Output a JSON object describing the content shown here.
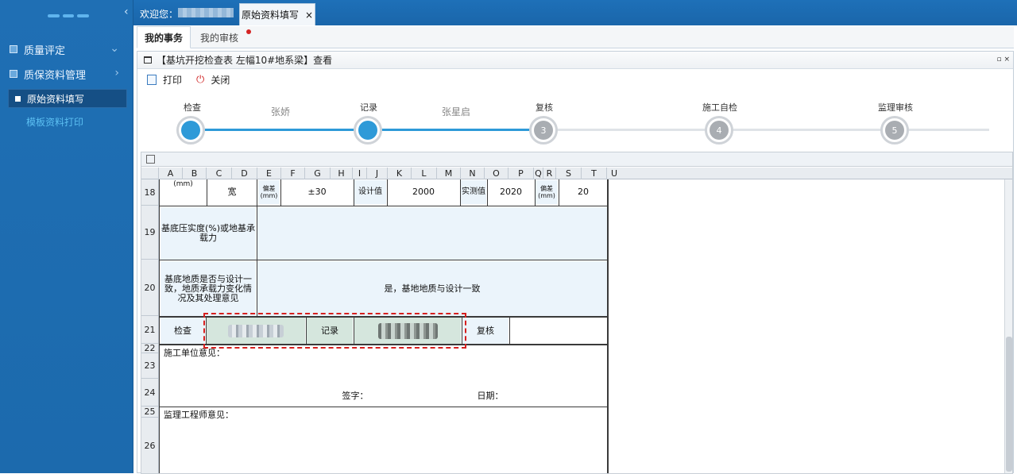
{
  "sidebar": {
    "items": [
      {
        "label": "质量评定",
        "expanded": true
      },
      {
        "label": "质保资料管理",
        "expanded": false
      }
    ],
    "subitems": [
      {
        "label": "原始资料填写",
        "active": true
      },
      {
        "label": "模板资料打印",
        "active": false
      }
    ]
  },
  "topbar": {
    "welcome": "欢迎您：",
    "tab_label": "原始资料填写",
    "tab_close": "×"
  },
  "subtabs": {
    "mine": "我的事务",
    "review": "我的审核"
  },
  "panel": {
    "title": "【基坑开挖检查表 左幅10#地系梁】查看",
    "controls": "▫ ×"
  },
  "toolbar": {
    "print": "打印",
    "close": "关闭"
  },
  "flow": {
    "steps": [
      {
        "label": "检查",
        "num": "",
        "state": "done"
      },
      {
        "label": "记录",
        "num": "",
        "state": "done"
      },
      {
        "label": "复核",
        "num": "3",
        "state": "todo"
      },
      {
        "label": "施工自检",
        "num": "4",
        "state": "todo"
      },
      {
        "label": "监理审核",
        "num": "5",
        "state": "todo"
      }
    ],
    "names": [
      "张娇",
      "张星启"
    ]
  },
  "sheet": {
    "columns": [
      "A",
      "B",
      "C",
      "D",
      "E",
      "F",
      "G",
      "H",
      "I",
      "J",
      "K",
      "L",
      "M",
      "N",
      "O",
      "P",
      "Q",
      "R",
      "S",
      "T",
      "U"
    ],
    "rows": [
      "18",
      "19",
      "20",
      "21",
      "22",
      "23",
      "24",
      "25",
      "26"
    ],
    "r18": {
      "unit": "(mm)",
      "dim": "宽",
      "dev": "偏差(mm)",
      "tol": "±30",
      "design": "设计值",
      "design_val": "2000",
      "actual": "实测值",
      "actual_val": "2020",
      "dev2": "偏差(mm)",
      "dev2_val": "20"
    },
    "r19": {
      "label": "基底压实度(%)或地基承载力"
    },
    "r20": {
      "label": "基底地质是否与设计一致，地质承载力变化情况及其处理意见",
      "value": "是，基地地质与设计一致"
    },
    "r21": {
      "check": "检查",
      "record": "记录",
      "review": "复核"
    },
    "r23": {
      "label": "施工单位意见："
    },
    "r24": {
      "sign": "签字：",
      "date": "日期："
    },
    "r25": {
      "label": "监理工程师意见："
    }
  },
  "colors": {
    "accent": "#2e9ad8",
    "sidebar": "#1e6fb3",
    "dashed_highlight": "#d6201f"
  }
}
